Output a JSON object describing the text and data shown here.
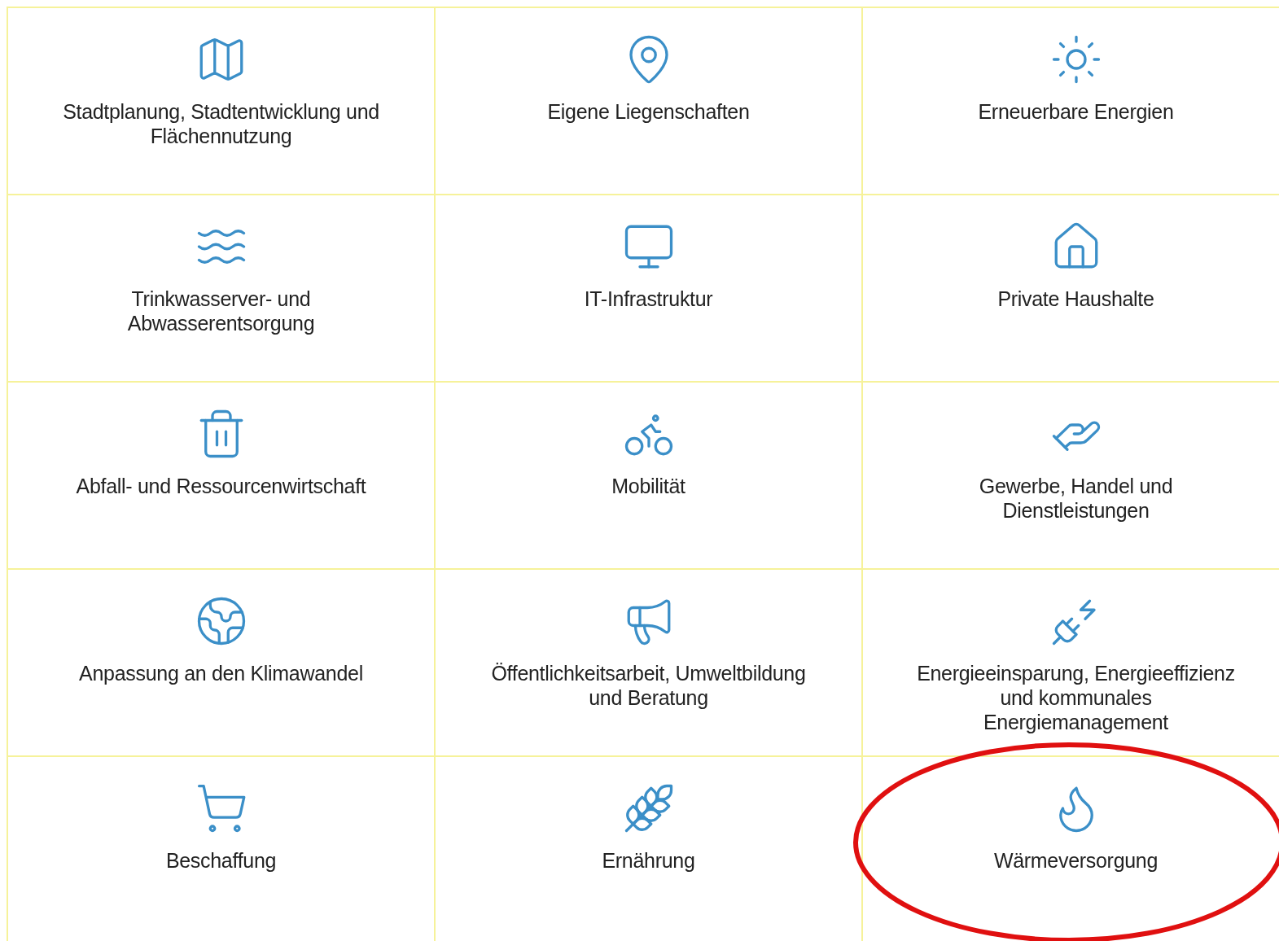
{
  "categories": [
    {
      "label": "Stadtplanung, Stadtentwicklung und Flächennutzung",
      "highlighted": false
    },
    {
      "label": "Eigene Liegenschaften",
      "highlighted": false
    },
    {
      "label": "Erneuerbare Energien",
      "highlighted": false
    },
    {
      "label": "Trinkwasserver- und Abwasserentsorgung",
      "highlighted": false
    },
    {
      "label": "IT-Infrastruktur",
      "highlighted": false
    },
    {
      "label": "Private Haushalte",
      "highlighted": false
    },
    {
      "label": "Abfall- und Ressourcenwirtschaft",
      "highlighted": false
    },
    {
      "label": "Mobilität",
      "highlighted": false
    },
    {
      "label": "Gewerbe, Handel und Dienstleistungen",
      "highlighted": false
    },
    {
      "label": "Anpassung an den Klimawandel",
      "highlighted": false
    },
    {
      "label": "Öffentlichkeitsarbeit, Umweltbildung und Beratung",
      "highlighted": false
    },
    {
      "label": "Energieeinsparung, Energieeffizienz und kommunales Energiemanagement",
      "highlighted": false
    },
    {
      "label": "Beschaffung",
      "highlighted": false
    },
    {
      "label": "Ernährung",
      "highlighted": false
    },
    {
      "label": "Wärmeversorgung",
      "highlighted": true
    }
  ]
}
